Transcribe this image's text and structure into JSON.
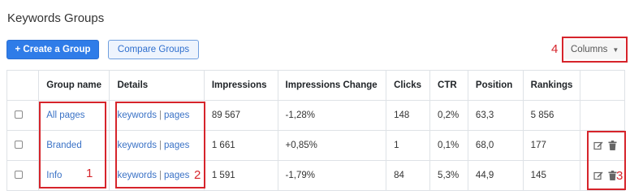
{
  "page": {
    "title": "Keywords Groups"
  },
  "toolbar": {
    "create_label": "+ Create a Group",
    "compare_label": "Compare Groups",
    "columns_label": "Columns"
  },
  "table": {
    "headers": [
      "",
      "Group name",
      "Details",
      "Impressions",
      "Impressions Change",
      "Clicks",
      "CTR",
      "Position",
      "Rankings",
      ""
    ],
    "detail_keywords": "keywords",
    "detail_sep": "|",
    "detail_pages": "pages",
    "rows": [
      {
        "name": "All pages",
        "impressions": "89 567",
        "change": "-1,28%",
        "clicks": "148",
        "ctr": "0,2%",
        "position": "63,3",
        "rankings": "5 856"
      },
      {
        "name": "Branded",
        "impressions": "1 661",
        "change": "+0,85%",
        "clicks": "1",
        "ctr": "0,1%",
        "position": "68,0",
        "rankings": "177"
      },
      {
        "name": "Info",
        "impressions": "1 591",
        "change": "-1,79%",
        "clicks": "84",
        "ctr": "5,3%",
        "position": "44,9",
        "rankings": "145"
      }
    ]
  },
  "annotations": {
    "n1": "1",
    "n2": "2",
    "n3": "3",
    "n4": "4"
  },
  "colors": {
    "accent": "#2f7ce8",
    "negative": "#e0556a",
    "positive": "#3fb5a0",
    "annotation": "#d6242b"
  },
  "icons": [
    "edit-icon",
    "trash-icon",
    "caret-down-icon"
  ]
}
